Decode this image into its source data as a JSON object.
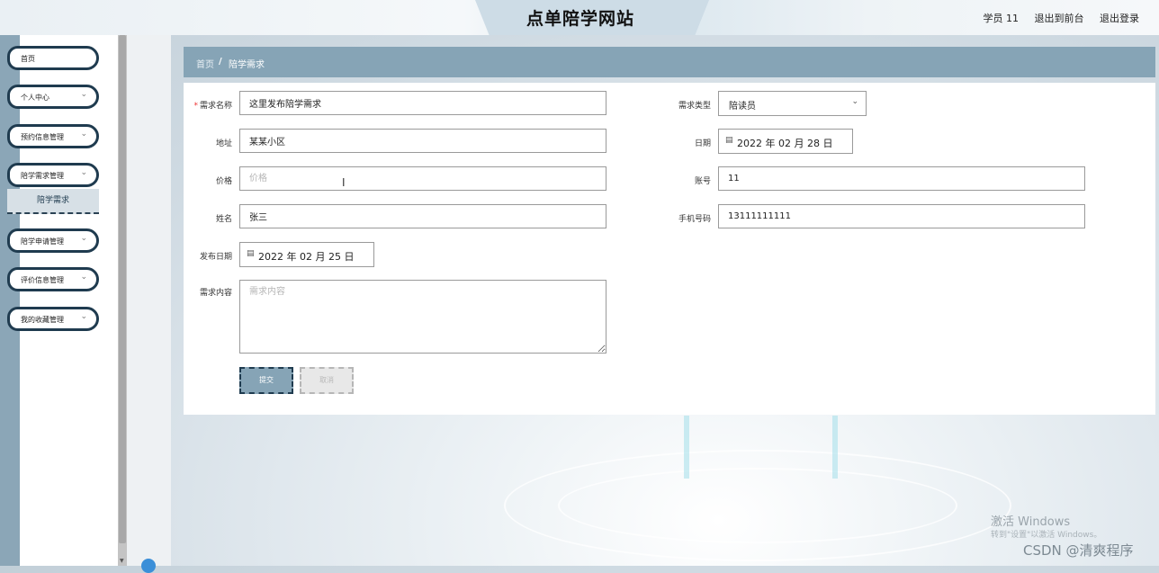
{
  "header": {
    "title": "点单陪学网站",
    "user": "学员 11",
    "back_to_front": "退出到前台",
    "logout": "退出登录"
  },
  "sidebar": {
    "items": [
      {
        "label": "首页"
      },
      {
        "label": "个人中心"
      },
      {
        "label": "预约信息管理"
      },
      {
        "label": "陪学需求管理"
      },
      {
        "label": "陪学申请管理"
      },
      {
        "label": "评价信息管理"
      },
      {
        "label": "我的收藏管理"
      }
    ],
    "active_sub": "陪学需求"
  },
  "breadcrumb": {
    "home": "首页",
    "separator": "/",
    "current": "陪学需求"
  },
  "form": {
    "demand_name": {
      "label": "需求名称",
      "value": "这里发布陪学需求"
    },
    "demand_type": {
      "label": "需求类型",
      "value": "陪读员"
    },
    "address": {
      "label": "地址",
      "value": "某某小区"
    },
    "date": {
      "label": "日期",
      "value": "2022 年 02 月 28 日"
    },
    "price": {
      "label": "价格",
      "placeholder": "价格"
    },
    "account": {
      "label": "账号",
      "value": "11"
    },
    "name": {
      "label": "姓名",
      "value": "张三"
    },
    "phone": {
      "label": "手机号码",
      "value": "13111111111"
    },
    "publish_date": {
      "label": "发布日期",
      "value": "2022 年 02 月 25 日"
    },
    "content": {
      "label": "需求内容",
      "placeholder": "需求内容"
    },
    "submit_label": "提交",
    "cancel_label": "取消"
  },
  "watermark": {
    "activate_title": "激活 Windows",
    "activate_sub": "转到\"设置\"以激活 Windows。",
    "csdn": "CSDN @清爽程序"
  },
  "colors": {
    "accent": "#86a4b6",
    "dark": "#1f3b4f",
    "required": "#e33333"
  }
}
